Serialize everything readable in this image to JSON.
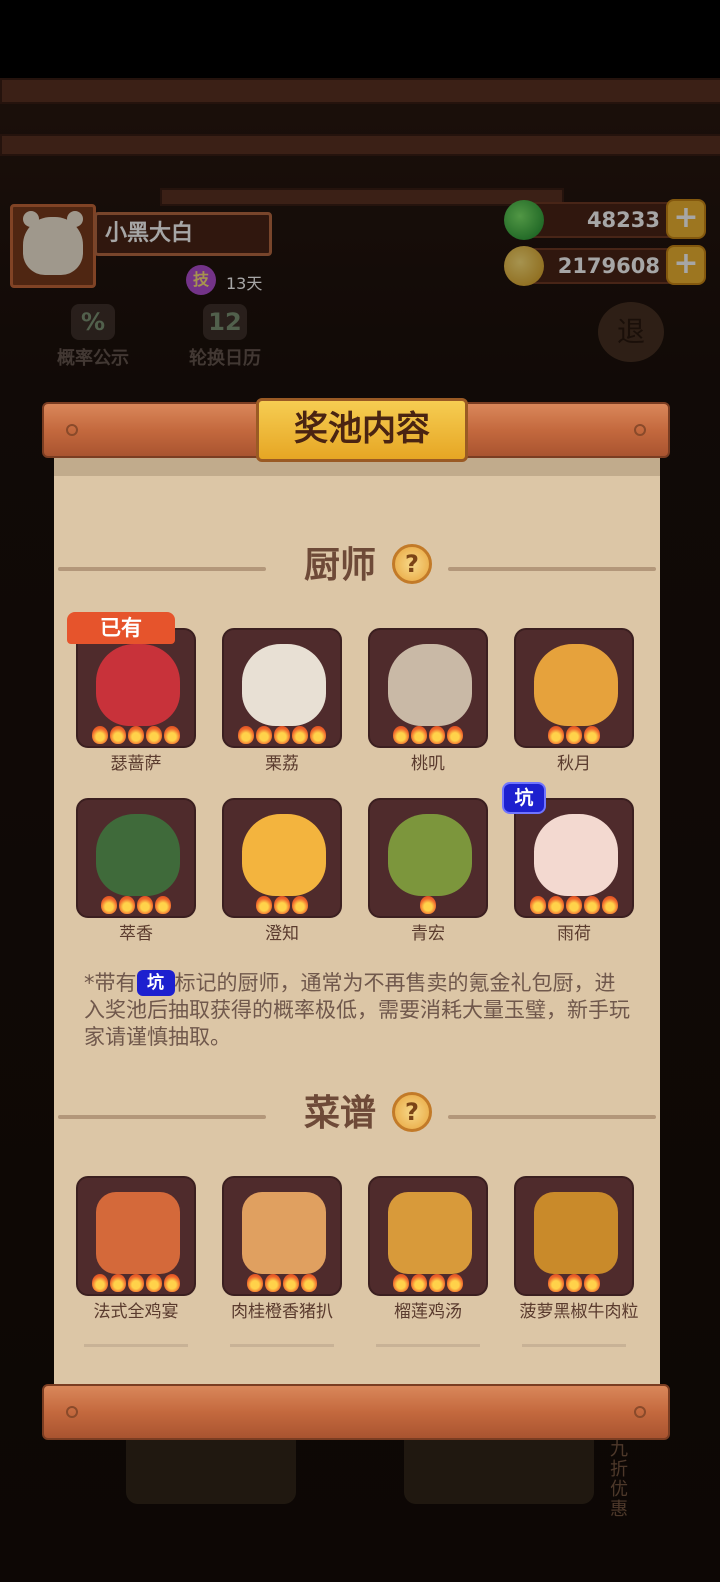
{
  "player": {
    "name": "小黑大白",
    "badge_icon": "技",
    "badge_days": "13天"
  },
  "currencies": [
    {
      "icon": "jade-icon",
      "value": "48233",
      "plus": "+"
    },
    {
      "icon": "coin-icon",
      "value": "2179608",
      "plus": "+"
    }
  ],
  "side_buttons": {
    "probability": {
      "icon": "%",
      "label": "概率公示"
    },
    "calendar": {
      "icon": "12",
      "label": "轮换日历"
    },
    "exit": "退"
  },
  "panel": {
    "title": "奖池内容",
    "chef_section": "厨师",
    "recipe_section": "菜谱",
    "help": "?",
    "owned_tag": "已有",
    "keng_tag": "坑",
    "note_prefix": "*带有",
    "note_inline_tag": "坑",
    "note_rest": "标记的厨师，通常为不再售卖的氪金礼包厨，进入奖池后抽取获得的概率极低，需要消耗大量玉璧，新手玩家请谨慎抽取。"
  },
  "chefs": [
    {
      "name": "瑟蔷萨",
      "flames": 5,
      "owned": true,
      "color": "#c8323a"
    },
    {
      "name": "栗荔",
      "flames": 5,
      "color": "#e8e0d4"
    },
    {
      "name": "桃叽",
      "flames": 4,
      "color": "#c9b9a6"
    },
    {
      "name": "秋月",
      "flames": 3,
      "color": "#e6a23c"
    },
    {
      "name": "萃香",
      "flames": 4,
      "color": "#3f6a3a"
    },
    {
      "name": "澄知",
      "flames": 3,
      "color": "#f3b43e"
    },
    {
      "name": "青宏",
      "flames": 1,
      "color": "#7c963c"
    },
    {
      "name": "雨荷",
      "flames": 5,
      "keng": true,
      "color": "#f3d9d0"
    }
  ],
  "recipes": [
    {
      "name": "法式全鸡宴",
      "flames": 5,
      "color": "#d4693a"
    },
    {
      "name": "肉桂橙香猪扒",
      "flames": 4,
      "color": "#e0a060"
    },
    {
      "name": "榴莲鸡汤",
      "flames": 4,
      "color": "#d89a3a"
    },
    {
      "name": "菠萝黑椒牛肉粒",
      "flames": 3,
      "color": "#c98a2a"
    }
  ],
  "bottom": {
    "discount": "九折优惠"
  }
}
